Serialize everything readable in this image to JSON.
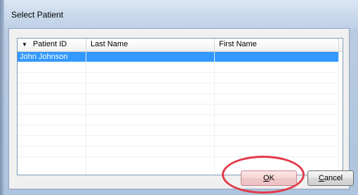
{
  "window": {
    "title": "Select Patient"
  },
  "table": {
    "sort_indicator": "▼",
    "columns": [
      "Patient ID",
      "Last Name",
      "First Name"
    ],
    "rows": [
      {
        "patient_id": "John Johnson",
        "last_name": "",
        "first_name": ""
      }
    ]
  },
  "buttons": {
    "ok_mnemonic": "O",
    "ok_rest": "K",
    "cancel_mnemonic": "C",
    "cancel_rest": "ancel"
  },
  "colors": {
    "selection": "#3399ff",
    "annotation_circle": "#e23b4a"
  }
}
